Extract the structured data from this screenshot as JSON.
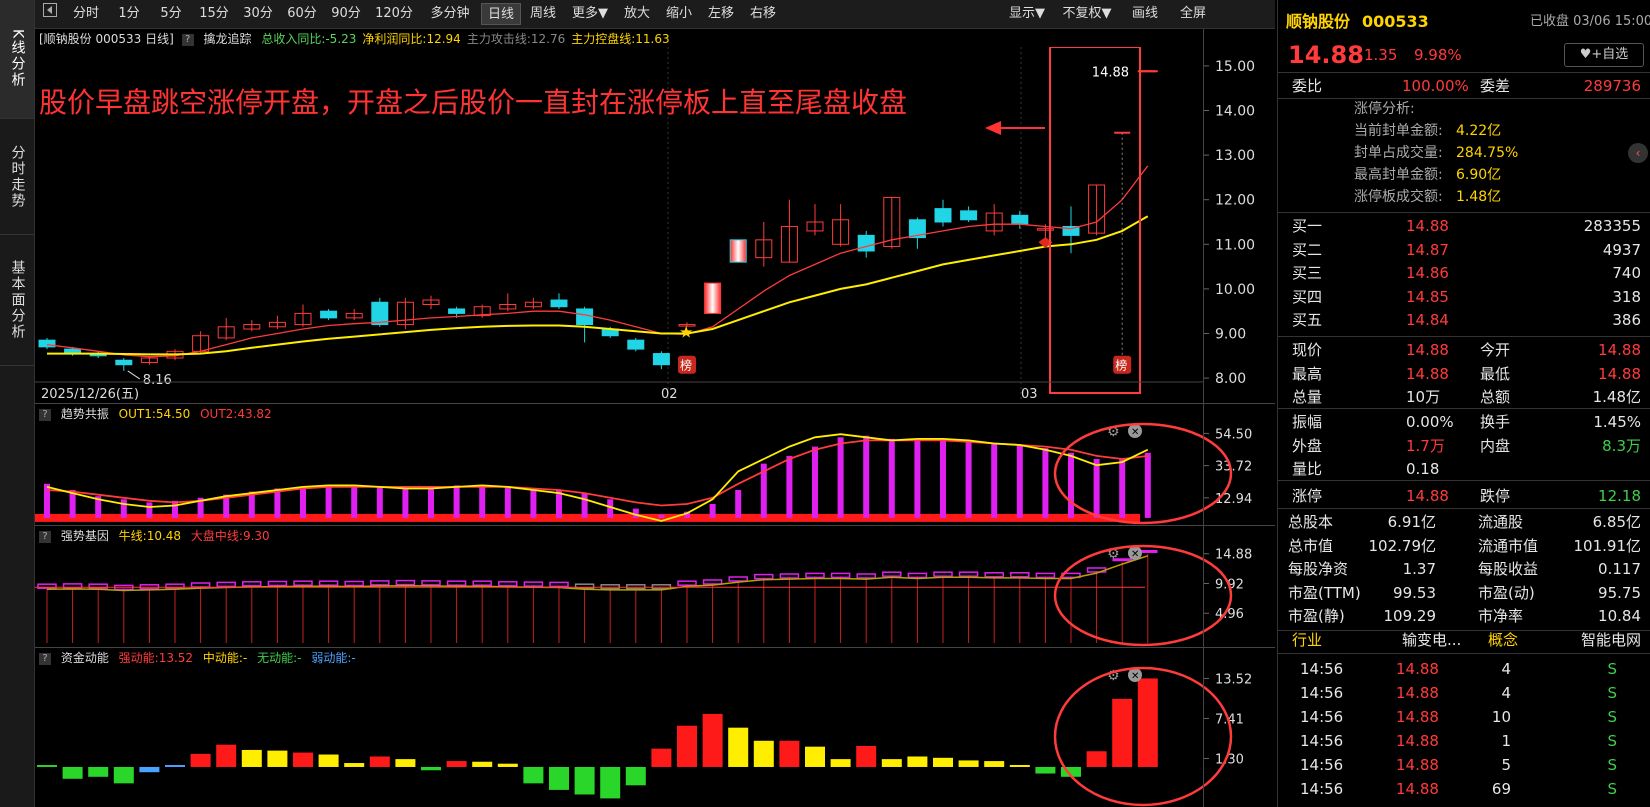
{
  "left_tabs": [
    "K线分析",
    "分时走势",
    "基本面分析"
  ],
  "toolbar": {
    "items": [
      "分时",
      "1分",
      "5分",
      "15分",
      "30分",
      "60分",
      "90分",
      "120分",
      "多分钟",
      "日线",
      "周线",
      "更多▼",
      "放大",
      "缩小",
      "左移",
      "右移"
    ],
    "active": "日线",
    "right_items": [
      "显示▼",
      "不复权▼",
      "画线",
      "全屏"
    ]
  },
  "main_chart": {
    "title": "[顺钠股份 000533 日线]",
    "indicator_name": "擒龙追踪",
    "stats": [
      {
        "label": "总收入同比:-5.23",
        "color": "#5ad35a"
      },
      {
        "label": "净利润同比:12.94",
        "color": "#ffd400"
      },
      {
        "label": "主力攻击线:12.76",
        "color": "#888888"
      },
      {
        "label": "主力控盘线:11.63",
        "color": "#ffd400"
      }
    ],
    "y_ticks": [
      "15.00",
      "14.00",
      "13.00",
      "12.00",
      "11.00",
      "10.00",
      "9.00",
      "8.00"
    ],
    "x_labels": [
      "2025/12/26(五)",
      "02",
      "03"
    ],
    "annotation": "股价早盘跳空涨停开盘，开盘之后股价一直封在涨停板上直至尾盘收盘",
    "last_price_label": "14.88",
    "low_label": "8.16",
    "bang_label": "榜"
  },
  "chart_data": [
    {
      "type": "candlestick",
      "y_range": [
        7.8,
        15.2
      ],
      "candles": [
        [
          8.85,
          8.7,
          8.9,
          8.65
        ],
        [
          8.65,
          8.55,
          8.7,
          8.5
        ],
        [
          8.55,
          8.5,
          8.6,
          8.45
        ],
        [
          8.4,
          8.3,
          8.45,
          8.16
        ],
        [
          8.35,
          8.45,
          8.5,
          8.3
        ],
        [
          8.45,
          8.6,
          8.65,
          8.4
        ],
        [
          8.6,
          8.95,
          9.05,
          8.55
        ],
        [
          8.9,
          9.15,
          9.35,
          8.85
        ],
        [
          9.1,
          9.2,
          9.3,
          9.05
        ],
        [
          9.15,
          9.25,
          9.4,
          9.1
        ],
        [
          9.2,
          9.45,
          9.65,
          9.15
        ],
        [
          9.5,
          9.35,
          9.55,
          9.3
        ],
        [
          9.35,
          9.45,
          9.55,
          9.3
        ],
        [
          9.7,
          9.2,
          9.8,
          9.15
        ],
        [
          9.2,
          9.7,
          9.8,
          9.1
        ],
        [
          9.65,
          9.75,
          9.85,
          9.55
        ],
        [
          9.55,
          9.45,
          9.6,
          9.35
        ],
        [
          9.4,
          9.6,
          9.65,
          9.35
        ],
        [
          9.55,
          9.65,
          9.9,
          9.5
        ],
        [
          9.6,
          9.7,
          9.8,
          9.55
        ],
        [
          9.75,
          9.6,
          9.9,
          9.55
        ],
        [
          9.55,
          9.2,
          9.6,
          8.8
        ],
        [
          9.1,
          8.95,
          9.15,
          8.9
        ],
        [
          8.85,
          8.65,
          8.9,
          8.6
        ],
        [
          8.55,
          8.3,
          8.6,
          8.2
        ],
        [
          9.2,
          9.2,
          9.25,
          9.15
        ],
        [
          9.45,
          10.13,
          10.13,
          9.45
        ],
        [
          11.1,
          10.6,
          11.1,
          10.6
        ],
        [
          10.7,
          11.1,
          11.5,
          10.5
        ],
        [
          10.6,
          11.4,
          12.0,
          10.6
        ],
        [
          11.3,
          11.5,
          11.9,
          11.2
        ],
        [
          11.0,
          11.55,
          11.9,
          10.95
        ],
        [
          11.2,
          10.85,
          11.3,
          10.7
        ],
        [
          10.95,
          12.05,
          12.05,
          10.9
        ],
        [
          11.55,
          11.15,
          11.6,
          10.9
        ],
        [
          11.8,
          11.5,
          12.0,
          11.4
        ],
        [
          11.75,
          11.55,
          11.85,
          11.5
        ],
        [
          11.3,
          11.7,
          11.9,
          11.2
        ],
        [
          11.65,
          11.45,
          11.75,
          11.35
        ],
        [
          11.35,
          11.35,
          11.45,
          11.0
        ],
        [
          11.4,
          11.2,
          11.85,
          10.8
        ],
        [
          11.25,
          12.33,
          12.33,
          11.2
        ],
        [
          13.5,
          13.5,
          13.5,
          13.5
        ],
        [
          14.88,
          14.88,
          14.88,
          14.88
        ]
      ],
      "ma_red": [
        8.75,
        8.68,
        8.6,
        8.52,
        8.48,
        8.5,
        8.6,
        8.75,
        8.9,
        9.0,
        9.1,
        9.18,
        9.22,
        9.25,
        9.3,
        9.35,
        9.38,
        9.42,
        9.45,
        9.5,
        9.5,
        9.42,
        9.3,
        9.15,
        9.0,
        8.98,
        9.15,
        9.55,
        9.95,
        10.3,
        10.55,
        10.8,
        10.95,
        11.1,
        11.2,
        11.3,
        11.4,
        11.45,
        11.45,
        11.4,
        11.35,
        11.5,
        12.0,
        12.76
      ],
      "ma_yellow": [
        8.55,
        8.55,
        8.55,
        8.54,
        8.53,
        8.53,
        8.55,
        8.6,
        8.68,
        8.75,
        8.82,
        8.88,
        8.93,
        8.98,
        9.03,
        9.08,
        9.12,
        9.15,
        9.17,
        9.18,
        9.18,
        9.15,
        9.1,
        9.05,
        9.0,
        9.0,
        9.1,
        9.3,
        9.5,
        9.7,
        9.85,
        10.0,
        10.1,
        10.25,
        10.4,
        10.55,
        10.65,
        10.75,
        10.85,
        10.95,
        11.0,
        11.1,
        11.3,
        11.63
      ]
    },
    {
      "type": "bar",
      "title": "趋势共振",
      "legend": [
        "OUT1:54.50",
        "OUT2:43.82"
      ],
      "y_ticks": [
        "54.50",
        "33.72",
        "12.94"
      ],
      "y_range": [
        -2,
        58
      ],
      "values": [
        22,
        18,
        14,
        12,
        10,
        11,
        13,
        15,
        17,
        19,
        20,
        21,
        21,
        20,
        19,
        20,
        21,
        21,
        20,
        19,
        18,
        16,
        12,
        6,
        2,
        4,
        9,
        18,
        35,
        40,
        46,
        52,
        53,
        51,
        50,
        50,
        49,
        48,
        47,
        45,
        42,
        38,
        38,
        42,
        54.5
      ],
      "out1": [
        20,
        16,
        12,
        9,
        7,
        8,
        11,
        14,
        16,
        18,
        20,
        21,
        21,
        20,
        19,
        19,
        20,
        21,
        20,
        18,
        16,
        12,
        7,
        2,
        -2,
        3,
        12,
        30,
        38,
        46,
        52,
        54,
        52,
        50,
        51,
        51,
        50,
        48,
        47,
        44,
        40,
        34,
        36,
        44,
        54.5
      ],
      "out2": [
        18,
        17,
        15,
        13,
        11,
        10,
        11,
        13,
        15,
        17,
        19,
        20,
        20,
        20,
        20,
        20,
        20,
        20,
        20,
        19,
        18,
        16,
        13,
        10,
        8,
        9,
        13,
        22,
        30,
        38,
        44,
        48,
        50,
        50,
        50,
        50,
        49,
        48,
        47,
        46,
        44,
        40,
        38,
        40,
        43.82
      ]
    },
    {
      "type": "bar",
      "title": "强势基因",
      "legend": [
        "牛线:10.48",
        "大盘中线:9.30"
      ],
      "y_ticks": [
        "14.88",
        "9.92",
        "4.96"
      ],
      "y_range": [
        0,
        15.5
      ],
      "values": [
        9.3,
        9.35,
        9.3,
        9.1,
        9.2,
        9.3,
        9.5,
        9.6,
        9.7,
        9.75,
        9.8,
        9.8,
        9.75,
        9.85,
        9.9,
        9.85,
        9.8,
        9.8,
        9.7,
        9.65,
        9.6,
        9.3,
        9.2,
        9.2,
        9.2,
        9.8,
        10.0,
        10.5,
        10.9,
        11.0,
        11.1,
        11.1,
        11.0,
        11.3,
        11.1,
        11.3,
        11.3,
        11.2,
        11.2,
        11.1,
        11.1,
        12.0,
        13.5,
        14.88
      ]
    },
    {
      "type": "bar",
      "title": "资金动能",
      "legend": [
        "强动能:13.52",
        "中动能:-",
        "无动能:-",
        "弱动能:-"
      ],
      "y_ticks": [
        "13.52",
        "7.41",
        "1.30"
      ],
      "y_range": [
        -5.5,
        14.5
      ],
      "values": [
        0.3,
        -1.8,
        -1.5,
        -2.5,
        -0.8,
        0.3,
        2.0,
        3.4,
        2.6,
        2.5,
        2.2,
        1.9,
        0.6,
        1.6,
        1.2,
        -0.5,
        0.9,
        0.8,
        0.5,
        -2.5,
        -3.5,
        -4.2,
        -4.8,
        -2.8,
        2.8,
        6.3,
        8.1,
        6.0,
        4.0,
        4.0,
        3.1,
        1.2,
        3.2,
        1.2,
        1.6,
        1.4,
        1.0,
        0.9,
        0.3,
        -1.0,
        -1.5,
        2.4,
        10.4,
        13.52
      ],
      "colors": [
        "g",
        "g",
        "g",
        "g",
        "b",
        "b",
        "r",
        "r",
        "y",
        "y",
        "r",
        "y",
        "y",
        "r",
        "y",
        "g",
        "r",
        "y",
        "y",
        "g",
        "g",
        "g",
        "g",
        "g",
        "r",
        "r",
        "r",
        "y",
        "y",
        "r",
        "y",
        "y",
        "r",
        "y",
        "y",
        "y",
        "y",
        "y",
        "y",
        "g",
        "g",
        "r",
        "r",
        "r"
      ]
    }
  ],
  "right_panel": {
    "name": "顺钠股份",
    "code": "000533",
    "status": "已收盘 03/06 15:00",
    "add_watch": "+自选",
    "price": "14.88",
    "change": "1.35",
    "change_pct": "9.98%",
    "weibi_label": "委比",
    "weibi": "100.00%",
    "weicha_label": "委差",
    "weicha": "289736",
    "limit_title": "涨停分析:",
    "limit_rows": [
      {
        "label": "当前封单金额:",
        "value": "4.22亿"
      },
      {
        "label": "封单占成交量:",
        "value": "284.75%"
      },
      {
        "label": "最高封单金额:",
        "value": "6.90亿"
      },
      {
        "label": "涨停板成交额:",
        "value": "1.48亿"
      }
    ],
    "bids": [
      {
        "label": "买一",
        "price": "14.88",
        "vol": "283355"
      },
      {
        "label": "买二",
        "price": "14.87",
        "vol": "4937"
      },
      {
        "label": "买三",
        "price": "14.86",
        "vol": "740"
      },
      {
        "label": "买四",
        "price": "14.85",
        "vol": "318"
      },
      {
        "label": "买五",
        "price": "14.84",
        "vol": "386"
      }
    ],
    "quote": [
      {
        "l1": "现价",
        "v1": "14.88",
        "c1": "red",
        "l2": "今开",
        "v2": "14.88",
        "c2": "red"
      },
      {
        "l1": "最高",
        "v1": "14.88",
        "c1": "red",
        "l2": "最低",
        "v2": "14.88",
        "c2": "red"
      },
      {
        "l1": "总量",
        "v1": "10万",
        "c1": "white",
        "l2": "总额",
        "v2": "1.48亿",
        "c2": "white"
      }
    ],
    "quote2": [
      {
        "l1": "振幅",
        "v1": "0.00%",
        "c1": "white",
        "l2": "换手",
        "v2": "1.45%",
        "c2": "white"
      },
      {
        "l1": "外盘",
        "v1": "1.7万",
        "c1": "red",
        "l2": "内盘",
        "v2": "8.3万",
        "c2": "green"
      },
      {
        "l1": "量比",
        "v1": "0.18",
        "c1": "white",
        "l2": "",
        "v2": "",
        "c2": "white"
      }
    ],
    "limit": {
      "l1": "涨停",
      "v1": "14.88",
      "l2": "跌停",
      "v2": "12.18"
    },
    "fundamentals": [
      {
        "l1": "总股本",
        "v1": "6.91亿",
        "l2": "流通股",
        "v2": "6.85亿"
      },
      {
        "l1": "总市值",
        "v1": "102.79亿",
        "l2": "流通市值",
        "v2": "101.91亿"
      },
      {
        "l1": "每股净资",
        "v1": "1.37",
        "l2": "每股收益",
        "v2": "0.117"
      },
      {
        "l1": "市盈(TTM)",
        "v1": "99.53",
        "l2": "市盈(动)",
        "v2": "95.75"
      },
      {
        "l1": "市盈(静)",
        "v1": "109.29",
        "l2": "市净率",
        "v2": "10.84"
      }
    ],
    "industry": {
      "l1": "行业",
      "v1": "输变电...",
      "l2": "概念",
      "v2": "智能电网"
    },
    "ticks": [
      {
        "t": "14:56",
        "p": "14.88",
        "v": "4",
        "s": "S"
      },
      {
        "t": "14:56",
        "p": "14.88",
        "v": "4",
        "s": "S"
      },
      {
        "t": "14:56",
        "p": "14.88",
        "v": "10",
        "s": "S"
      },
      {
        "t": "14:56",
        "p": "14.88",
        "v": "1",
        "s": "S"
      },
      {
        "t": "14:56",
        "p": "14.88",
        "v": "5",
        "s": "S"
      },
      {
        "t": "14:56",
        "p": "14.88",
        "v": "69",
        "s": "S"
      }
    ]
  }
}
